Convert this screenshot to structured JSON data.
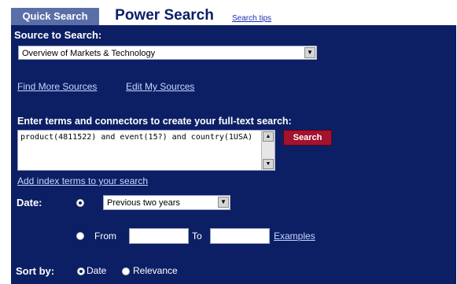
{
  "tabs": {
    "quick_search": "Quick Search",
    "power_search": "Power Search",
    "search_tips": "Search tips"
  },
  "source": {
    "label": "Source to Search:",
    "selected": "Overview of Markets & Technology",
    "find_more": "Find More Sources",
    "edit_my": "Edit My Sources"
  },
  "query": {
    "label": "Enter terms and connectors to create your full-text search:",
    "value": "product(4811522) and event(15?) and country(1USA)",
    "search_button": "Search",
    "add_index": "Add index terms to your search"
  },
  "date": {
    "label": "Date:",
    "preset_selected": "Previous two years",
    "from_label": "From",
    "to_label": "To",
    "examples": "Examples"
  },
  "sort": {
    "label": "Sort by:",
    "date_option": "Date",
    "relevance_option": "Relevance",
    "selected": "Date"
  },
  "colors": {
    "panel": "#0c1f64",
    "tab_inactive": "#5a6fa8",
    "search_button": "#a3122e"
  }
}
